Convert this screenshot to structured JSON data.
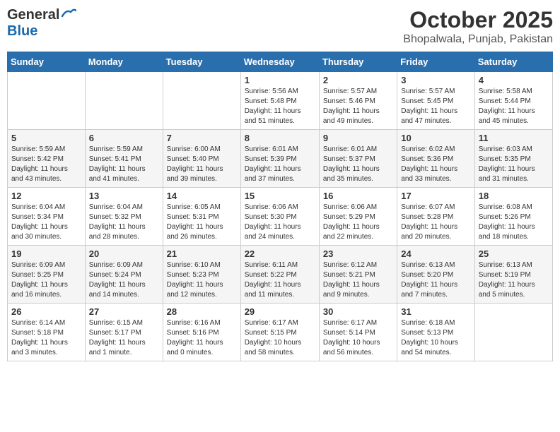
{
  "header": {
    "logo_general": "General",
    "logo_blue": "Blue",
    "title": "October 2025",
    "subtitle": "Bhopalwala, Punjab, Pakistan"
  },
  "calendar": {
    "days_of_week": [
      "Sunday",
      "Monday",
      "Tuesday",
      "Wednesday",
      "Thursday",
      "Friday",
      "Saturday"
    ],
    "weeks": [
      [
        {
          "day": "",
          "info": ""
        },
        {
          "day": "",
          "info": ""
        },
        {
          "day": "",
          "info": ""
        },
        {
          "day": "1",
          "info": "Sunrise: 5:56 AM\nSunset: 5:48 PM\nDaylight: 11 hours\nand 51 minutes."
        },
        {
          "day": "2",
          "info": "Sunrise: 5:57 AM\nSunset: 5:46 PM\nDaylight: 11 hours\nand 49 minutes."
        },
        {
          "day": "3",
          "info": "Sunrise: 5:57 AM\nSunset: 5:45 PM\nDaylight: 11 hours\nand 47 minutes."
        },
        {
          "day": "4",
          "info": "Sunrise: 5:58 AM\nSunset: 5:44 PM\nDaylight: 11 hours\nand 45 minutes."
        }
      ],
      [
        {
          "day": "5",
          "info": "Sunrise: 5:59 AM\nSunset: 5:42 PM\nDaylight: 11 hours\nand 43 minutes."
        },
        {
          "day": "6",
          "info": "Sunrise: 5:59 AM\nSunset: 5:41 PM\nDaylight: 11 hours\nand 41 minutes."
        },
        {
          "day": "7",
          "info": "Sunrise: 6:00 AM\nSunset: 5:40 PM\nDaylight: 11 hours\nand 39 minutes."
        },
        {
          "day": "8",
          "info": "Sunrise: 6:01 AM\nSunset: 5:39 PM\nDaylight: 11 hours\nand 37 minutes."
        },
        {
          "day": "9",
          "info": "Sunrise: 6:01 AM\nSunset: 5:37 PM\nDaylight: 11 hours\nand 35 minutes."
        },
        {
          "day": "10",
          "info": "Sunrise: 6:02 AM\nSunset: 5:36 PM\nDaylight: 11 hours\nand 33 minutes."
        },
        {
          "day": "11",
          "info": "Sunrise: 6:03 AM\nSunset: 5:35 PM\nDaylight: 11 hours\nand 31 minutes."
        }
      ],
      [
        {
          "day": "12",
          "info": "Sunrise: 6:04 AM\nSunset: 5:34 PM\nDaylight: 11 hours\nand 30 minutes."
        },
        {
          "day": "13",
          "info": "Sunrise: 6:04 AM\nSunset: 5:32 PM\nDaylight: 11 hours\nand 28 minutes."
        },
        {
          "day": "14",
          "info": "Sunrise: 6:05 AM\nSunset: 5:31 PM\nDaylight: 11 hours\nand 26 minutes."
        },
        {
          "day": "15",
          "info": "Sunrise: 6:06 AM\nSunset: 5:30 PM\nDaylight: 11 hours\nand 24 minutes."
        },
        {
          "day": "16",
          "info": "Sunrise: 6:06 AM\nSunset: 5:29 PM\nDaylight: 11 hours\nand 22 minutes."
        },
        {
          "day": "17",
          "info": "Sunrise: 6:07 AM\nSunset: 5:28 PM\nDaylight: 11 hours\nand 20 minutes."
        },
        {
          "day": "18",
          "info": "Sunrise: 6:08 AM\nSunset: 5:26 PM\nDaylight: 11 hours\nand 18 minutes."
        }
      ],
      [
        {
          "day": "19",
          "info": "Sunrise: 6:09 AM\nSunset: 5:25 PM\nDaylight: 11 hours\nand 16 minutes."
        },
        {
          "day": "20",
          "info": "Sunrise: 6:09 AM\nSunset: 5:24 PM\nDaylight: 11 hours\nand 14 minutes."
        },
        {
          "day": "21",
          "info": "Sunrise: 6:10 AM\nSunset: 5:23 PM\nDaylight: 11 hours\nand 12 minutes."
        },
        {
          "day": "22",
          "info": "Sunrise: 6:11 AM\nSunset: 5:22 PM\nDaylight: 11 hours\nand 11 minutes."
        },
        {
          "day": "23",
          "info": "Sunrise: 6:12 AM\nSunset: 5:21 PM\nDaylight: 11 hours\nand 9 minutes."
        },
        {
          "day": "24",
          "info": "Sunrise: 6:13 AM\nSunset: 5:20 PM\nDaylight: 11 hours\nand 7 minutes."
        },
        {
          "day": "25",
          "info": "Sunrise: 6:13 AM\nSunset: 5:19 PM\nDaylight: 11 hours\nand 5 minutes."
        }
      ],
      [
        {
          "day": "26",
          "info": "Sunrise: 6:14 AM\nSunset: 5:18 PM\nDaylight: 11 hours\nand 3 minutes."
        },
        {
          "day": "27",
          "info": "Sunrise: 6:15 AM\nSunset: 5:17 PM\nDaylight: 11 hours\nand 1 minute."
        },
        {
          "day": "28",
          "info": "Sunrise: 6:16 AM\nSunset: 5:16 PM\nDaylight: 11 hours\nand 0 minutes."
        },
        {
          "day": "29",
          "info": "Sunrise: 6:17 AM\nSunset: 5:15 PM\nDaylight: 10 hours\nand 58 minutes."
        },
        {
          "day": "30",
          "info": "Sunrise: 6:17 AM\nSunset: 5:14 PM\nDaylight: 10 hours\nand 56 minutes."
        },
        {
          "day": "31",
          "info": "Sunrise: 6:18 AM\nSunset: 5:13 PM\nDaylight: 10 hours\nand 54 minutes."
        },
        {
          "day": "",
          "info": ""
        }
      ]
    ]
  }
}
